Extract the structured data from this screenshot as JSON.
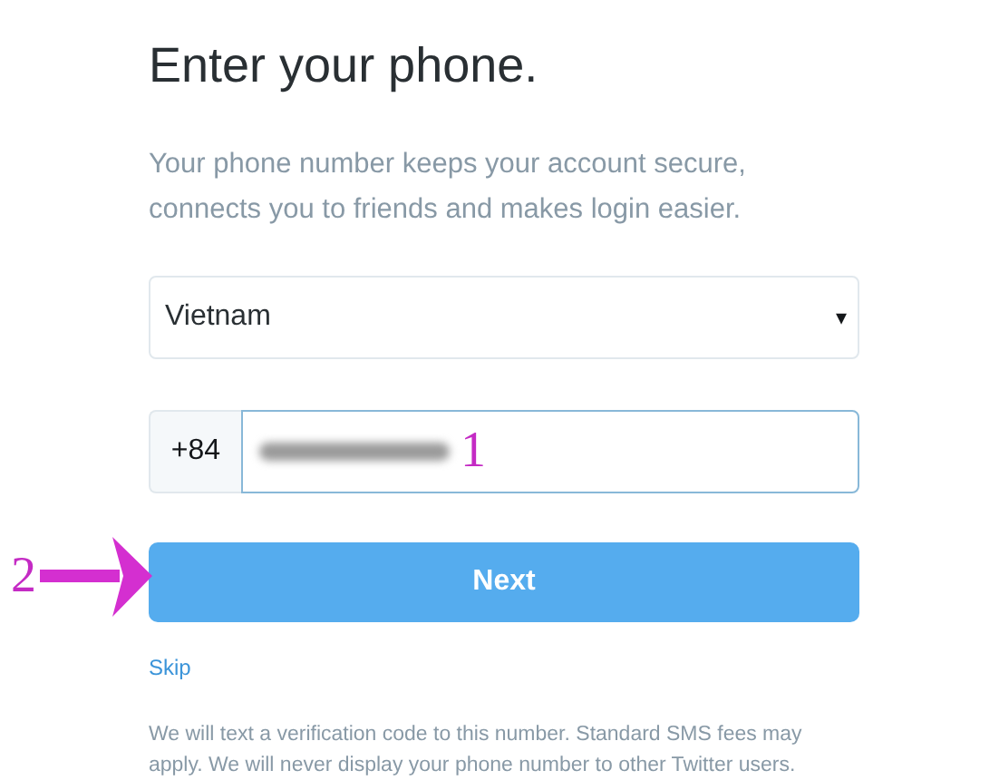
{
  "title": "Enter your phone.",
  "subtitle": "Your phone number keeps your account secure, connects you to friends and makes login easier.",
  "country_select": {
    "value": "Vietnam",
    "caret": "▾"
  },
  "phone": {
    "code": "+84",
    "annotation": "1"
  },
  "next_button": {
    "label": "Next",
    "annotation": "2"
  },
  "skip_link": "Skip",
  "footer": "We will text a verification code to this number. Standard SMS fees may apply. We will never display your phone number to other Twitter users."
}
